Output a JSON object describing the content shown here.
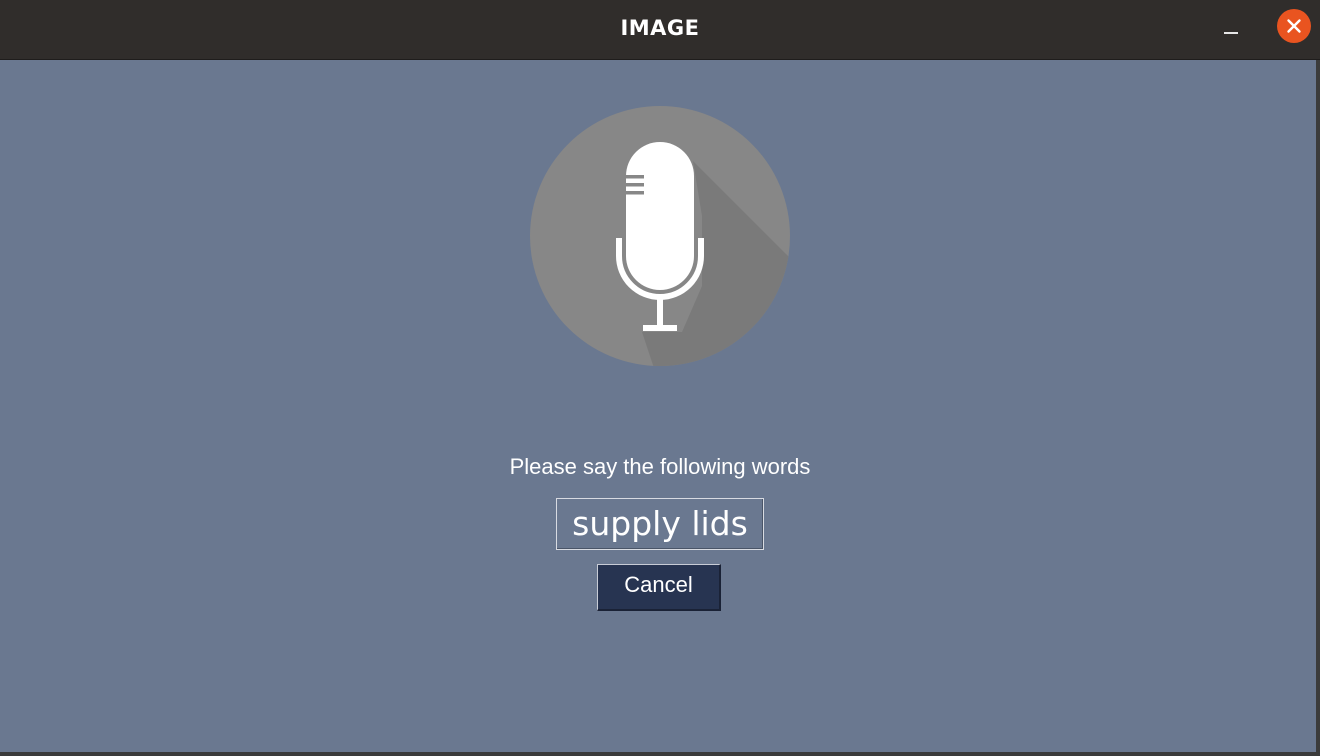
{
  "window": {
    "title": "IMAGE",
    "controls": {
      "minimize_icon": "minimize-icon",
      "close_icon": "close-icon",
      "close_color": "#e95420"
    }
  },
  "main": {
    "microphone_icon": "microphone-icon",
    "prompt": "Please say the following words",
    "words": "supply lids",
    "cancel_label": "Cancel"
  },
  "colors": {
    "background": "#6a7890",
    "titlebar": "#302d2b",
    "mic_circle": "#878787",
    "cancel_button": "#273451"
  }
}
